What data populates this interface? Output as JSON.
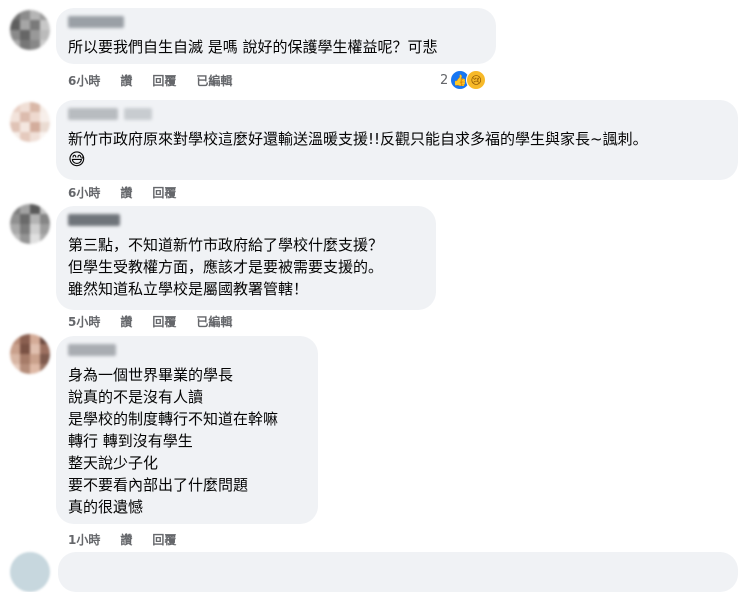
{
  "comments": [
    {
      "text": "所以要我們自生自滅 是嗎 說好的保護學生權益呢？可悲",
      "meta": {
        "time": "6小時",
        "like": "讚",
        "reply": "回覆",
        "edited": "已編輯"
      },
      "reactions": {
        "count": "2",
        "icons": [
          "like-icon",
          "sad-icon"
        ]
      },
      "colors": [
        "#6f6f6f",
        "#8c8c8c",
        "#b5b5b5",
        "#5e5e5e"
      ]
    },
    {
      "text": "新竹市政府原來對學校這麼好還輸送溫暖支援!!反觀只能自求多福的學生與家長~諷刺。",
      "emoji": "😅",
      "meta": {
        "time": "6小時",
        "like": "讚",
        "reply": "回覆"
      },
      "colors": [
        "#e8cfc4",
        "#f0dfd6",
        "#d9b8a8",
        "#f5ece6"
      ]
    },
    {
      "lines": [
        "第三點，不知道新竹市政府給了學校什麼支援？",
        "但學生受教權方面，應該才是要被需要支援的。",
        "雖然知道私立學校是屬國教署管轄！"
      ],
      "meta": {
        "time": "5小時",
        "like": "讚",
        "reply": "回覆",
        "edited": "已編輯"
      },
      "colors": [
        "#7d7d7d",
        "#a3a3a3",
        "#5a5a5a",
        "#c2c2c2"
      ]
    },
    {
      "lines": [
        "身為一個世界畢業的學長",
        "說真的不是沒有人讀",
        "是學校的制度轉行不知道在幹嘛",
        "轉行 轉到沒有學生",
        "整天說少子化",
        "要不要看內部出了什麼問題",
        "真的很遺憾"
      ],
      "meta": {
        "time": "1小時",
        "like": "讚",
        "reply": "回覆"
      },
      "colors": [
        "#b98c78",
        "#8a5f50",
        "#d4ab97",
        "#6b4a40"
      ]
    }
  ]
}
